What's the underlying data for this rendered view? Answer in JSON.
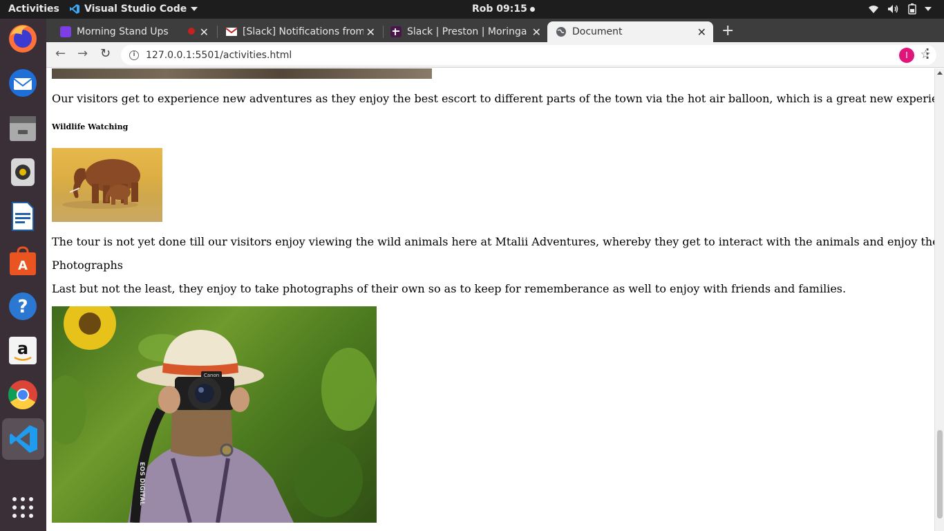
{
  "topbar": {
    "activities": "Activities",
    "app_name": "Visual Studio Code",
    "clock": "Rob 09:15"
  },
  "dock": {
    "apps": [
      "firefox-icon",
      "thunderbird-icon",
      "files-icon",
      "rhythmbox-icon",
      "libreoffice-writer-icon",
      "ubuntu-software-icon",
      "help-icon",
      "amazon-icon",
      "chrome-icon",
      "vscode-icon"
    ]
  },
  "browser": {
    "tabs": [
      {
        "title": "Morning Stand Ups",
        "favicon_color": "#7b3fe4"
      },
      {
        "title": "[Slack] Notifications from",
        "favicon_color": "#c5221f"
      },
      {
        "title": "Slack | Preston | Moringa S",
        "favicon_color": "#4a154b"
      },
      {
        "title": "Document",
        "favicon_color": "#5f6368"
      }
    ],
    "url_host": "127.0.0.1",
    "url_path": ":5501/activities.html",
    "profile_initial": "I"
  },
  "page": {
    "balloon_text": "Our visitors get to experience new adventures as they enjoy the best escort to different parts of the town via the hot air balloon, which is a great new experience and they enjoy it.",
    "wildlife_heading": "Wildlife Watching",
    "wildlife_text": "The tour is not yet done till our visitors enjoy viewing the wild animals here at Mtalii Adventures, whereby they get to interact with the animals and enjoy their company.",
    "photographs_heading": "Photographs",
    "photographs_text": "Last but not the least, they enjoy to take photographs of their own so as to keep for rememberance as well to enjoy with friends and families.",
    "camera_brand": "Canon",
    "strap_text": "EOS DIGITAL"
  }
}
